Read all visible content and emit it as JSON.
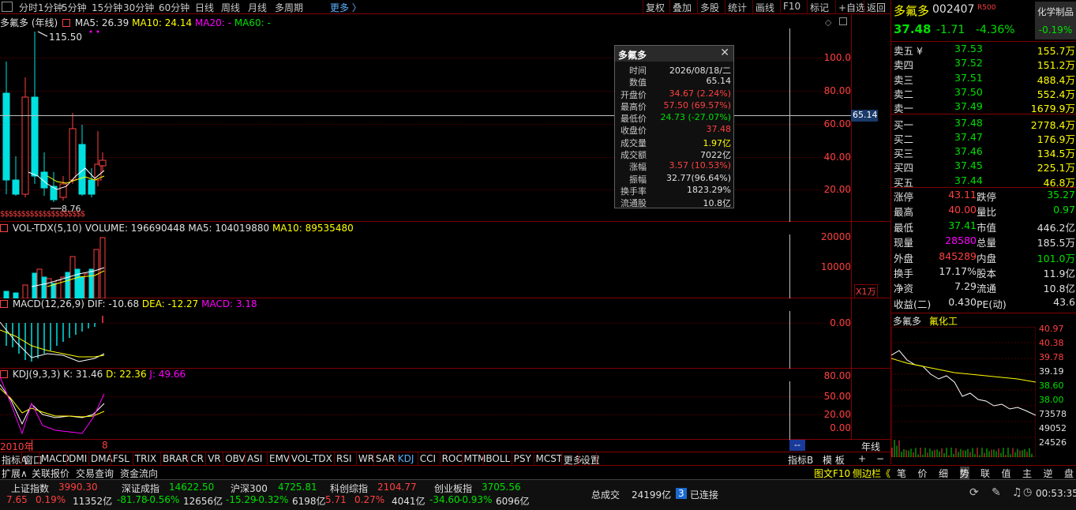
{
  "topbar": {
    "periods": [
      "分时",
      "1分钟",
      "5分钟",
      "15分钟",
      "30分钟",
      "60分钟",
      "日线",
      "周线",
      "月线",
      "多周期"
    ],
    "more": "更多 〉",
    "right_buttons": [
      "复权",
      "叠加",
      "多股",
      "统计",
      "画线",
      "F10",
      "标记",
      "+自选",
      "返回"
    ]
  },
  "main_panel": {
    "title_name": "多氟多 (年线)",
    "ma5": "MA5: 26.39",
    "ma10": "MA10: 24.14",
    "ma20": "MA20: -",
    "ma60": "MA60: -",
    "high_label": "115.50",
    "low_label": "8.76",
    "yticks": [
      "100.0",
      "80.00",
      "60.00",
      "40.00",
      "20.00"
    ],
    "crosshair_value": "65.14",
    "dollar_marks": "$$$$$$$$$$$$$$$$$$$$"
  },
  "vol_panel": {
    "title": "VOL-TDX(5,10)",
    "volume": "VOLUME: 196690448",
    "ma5": "MA5: 104019880",
    "ma10": "MA10: 89535480",
    "yticks": [
      "20000",
      "10000"
    ],
    "unit": "X1万"
  },
  "macd_panel": {
    "title": "MACD(12,26,9)",
    "dif": "DIF: -10.68",
    "dea": "DEA: -12.27",
    "macd": "MACD: 3.18",
    "yticks": [
      "0.00"
    ]
  },
  "kdj_panel": {
    "title": "KDJ(9,3,3)",
    "k": "K: 31.46",
    "d": "D: 22.36",
    "j": "J: 49.66",
    "yticks": [
      "80.00",
      "50.00",
      "20.00",
      "0.00"
    ]
  },
  "xaxis": {
    "start": "2010年",
    "mark": "8",
    "cursor": "--",
    "period": "年线"
  },
  "tooltip": {
    "title": "多氟多",
    "rows": [
      {
        "k": "时间",
        "v": "2026/08/18/二",
        "c": "#e0e0e0"
      },
      {
        "k": "数值",
        "v": "65.14",
        "c": "#e0e0e0"
      },
      {
        "k": "开盘价",
        "v": "34.67 (2.24%)",
        "c": "#ff4040"
      },
      {
        "k": "最高价",
        "v": "57.50 (69.57%)",
        "c": "#ff4040"
      },
      {
        "k": "最低价",
        "v": "24.73 (-27.07%)",
        "c": "#00e000"
      },
      {
        "k": "收盘价",
        "v": "37.48",
        "c": "#ff4040"
      },
      {
        "k": "成交量",
        "v": "1.97亿",
        "c": "#ffff00"
      },
      {
        "k": "成交额",
        "v": "7022亿",
        "c": "#e0e0e0"
      },
      {
        "k": "涨幅",
        "v": "3.57 (10.53%)",
        "c": "#ff4040"
      },
      {
        "k": "振幅",
        "v": "32.77(96.64%)",
        "c": "#e0e0e0"
      },
      {
        "k": "换手率",
        "v": "1823.29%",
        "c": "#e0e0e0"
      },
      {
        "k": "流通股",
        "v": "10.8亿",
        "c": "#e0e0e0"
      }
    ]
  },
  "quote": {
    "name": "多氟多",
    "code": "002407",
    "rtag": "R500",
    "sector": "化学制品",
    "sector_chg": "-0.19%",
    "price": "37.48",
    "change": "-1.71",
    "pct": "-4.36%",
    "sells": [
      {
        "l": "卖五 ¥",
        "p": "37.53",
        "v": "155.7万"
      },
      {
        "l": "卖四",
        "p": "37.52",
        "v": "151.2万"
      },
      {
        "l": "卖三",
        "p": "37.51",
        "v": "488.4万"
      },
      {
        "l": "卖二",
        "p": "37.50",
        "v": "552.4万"
      },
      {
        "l": "卖一",
        "p": "37.49",
        "v": "1679.9万"
      }
    ],
    "buys": [
      {
        "l": "买一",
        "p": "37.48",
        "v": "2778.4万"
      },
      {
        "l": "买二",
        "p": "37.47",
        "v": "176.9万"
      },
      {
        "l": "买三",
        "p": "37.46",
        "v": "134.5万"
      },
      {
        "l": "买四",
        "p": "37.45",
        "v": "225.1万"
      },
      {
        "l": "买五",
        "p": "37.44",
        "v": "46.8万"
      }
    ],
    "stats": [
      {
        "l1": "涨停",
        "v1": "43.11",
        "c1": "#ff4040",
        "l2": "跌停",
        "v2": "35.27",
        "c2": "#00e000"
      },
      {
        "l1": "最高",
        "v1": "40.00",
        "c1": "#ff4040",
        "l2": "量比",
        "v2": "0.97",
        "c2": "#00e000"
      },
      {
        "l1": "最低",
        "v1": "37.41",
        "c1": "#00e000",
        "l2": "市值",
        "v2": "446.2亿",
        "c2": "#e0e0e0"
      },
      {
        "l1": "现量",
        "v1": "28580",
        "c1": "#ff00ff",
        "l2": "总量",
        "v2": "185.5万",
        "c2": "#e0e0e0"
      },
      {
        "l1": "外盘",
        "v1": "845289",
        "c1": "#ff4040",
        "l2": "内盘",
        "v2": "101.0万",
        "c2": "#00e000"
      },
      {
        "l1": "换手",
        "v1": "17.17%",
        "c1": "#e0e0e0",
        "l2": "股本",
        "v2": "11.9亿",
        "c2": "#e0e0e0"
      },
      {
        "l1": "净资",
        "v1": "7.29",
        "c1": "#e0e0e0",
        "l2": "流通",
        "v2": "10.8亿",
        "c2": "#e0e0e0"
      },
      {
        "l1": "收益(二)",
        "v1": "0.430",
        "c1": "#e0e0e0",
        "l2": "PE(动)",
        "v2": "43.6",
        "c2": "#e0e0e0"
      }
    ]
  },
  "mini": {
    "tab1": "多氟多",
    "tab2": "氟化工",
    "prices": [
      "40.97",
      "40.38",
      "39.78",
      "39.19",
      "38.60",
      "38.00"
    ],
    "vols": [
      "73578",
      "49052",
      "24526"
    ]
  },
  "indicators": [
    "指标A",
    "窗口",
    "MACD",
    "DMI",
    "DMA",
    "FSL",
    "TRIX",
    "BRAR",
    "CR",
    "VR",
    "OBV",
    "ASI",
    "EMV",
    "VOL-TDX",
    "RSI",
    "WR",
    "SAR",
    "KDJ",
    "CCI",
    "ROC",
    "MTM",
    "BOLL",
    "PSY",
    "MCST",
    "更多",
    "设置"
  ],
  "ind_right": [
    "指标B",
    "模 板",
    "+",
    "−"
  ],
  "row2_left": [
    "扩展∧",
    "关联报价",
    "交易查询",
    "资金流向"
  ],
  "row2_right": [
    "图文F10",
    "侧边栏《"
  ],
  "row2_tabs": [
    "笔",
    "价",
    "细",
    "势",
    "联",
    "值",
    "主",
    "逆",
    "盘"
  ],
  "indices": [
    {
      "name": "上证指数",
      "val": "3990.30",
      "chg": "7.65",
      "pct": "0.19%",
      "amt": "11352亿",
      "c": "#ff4040"
    },
    {
      "name": "深证成指",
      "val": "14622.50",
      "chg": "-81.78",
      "pct": "-0.56%",
      "amt": "12656亿",
      "c": "#00e000"
    },
    {
      "name": "沪深300",
      "val": "4725.81",
      "chg": "-15.29",
      "pct": "-0.32%",
      "amt": "6198亿",
      "c": "#00e000"
    },
    {
      "name": "科创综指",
      "val": "2104.77",
      "chg": "5.71",
      "pct": "0.27%",
      "amt": "4041亿",
      "c": "#ff4040"
    },
    {
      "name": "创业板指",
      "val": "3705.56",
      "chg": "-34.60",
      "pct": "-0.93%",
      "amt": "6096亿",
      "c": "#00e000"
    }
  ],
  "status": {
    "total_label": "总成交",
    "total": "24199亿",
    "conn_num": "3",
    "conn": "已连接",
    "clock": "00:53:35"
  }
}
